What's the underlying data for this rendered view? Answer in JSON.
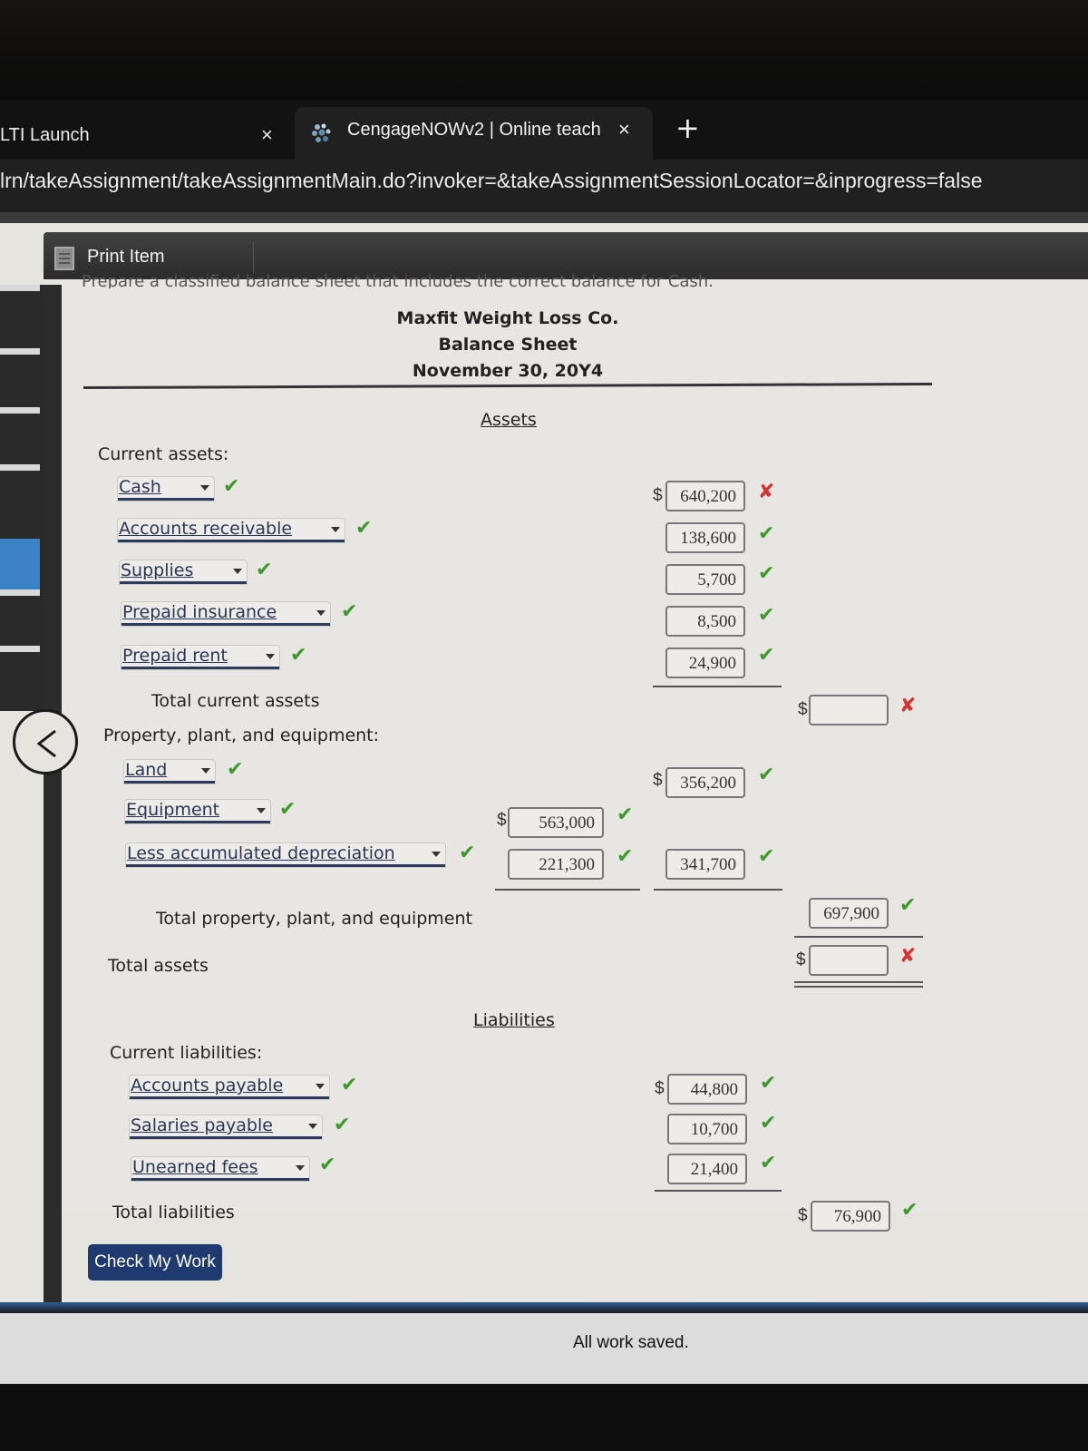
{
  "browser": {
    "tabs": [
      {
        "label": "LTI Launch",
        "active": false
      },
      {
        "label": "CengageNOWv2 | Online teach",
        "active": true
      }
    ],
    "url": "lrn/takeAssignment/takeAssignmentMain.do?invoker=&takeAssignmentSessionLocator=&inprogress=false"
  },
  "toolbar": {
    "print_label": "Print Item"
  },
  "instructions": "Prepare a classified balance sheet that includes the correct balance for Cash.",
  "header": {
    "company": "Maxfit Weight Loss Co.",
    "statement": "Balance Sheet",
    "date": "November 30, 20Y4"
  },
  "assets": {
    "title": "Assets",
    "current_label": "Current assets:",
    "current_items": [
      {
        "account": "Cash",
        "account_status": "correct",
        "amount": "640,200",
        "amount_status": "incorrect",
        "dollar": true
      },
      {
        "account": "Accounts receivable",
        "account_status": "correct",
        "amount": "138,600",
        "amount_status": "correct",
        "dollar": false
      },
      {
        "account": "Supplies",
        "account_status": "correct",
        "amount": "5,700",
        "amount_status": "correct",
        "dollar": false
      },
      {
        "account": "Prepaid insurance",
        "account_status": "correct",
        "amount": "8,500",
        "amount_status": "correct",
        "dollar": false
      },
      {
        "account": "Prepaid rent",
        "account_status": "correct",
        "amount": "24,900",
        "amount_status": "correct",
        "dollar": false
      }
    ],
    "total_current_label": "Total current assets",
    "total_current_value": "",
    "total_current_status": "incorrect",
    "ppe_label": "Property, plant, and equipment:",
    "ppe_items": [
      {
        "account": "Land",
        "account_status": "correct",
        "amount": "356,200",
        "amount_status": "correct"
      },
      {
        "account": "Equipment",
        "account_status": "correct",
        "amount": "563,000",
        "amount_status": "correct"
      },
      {
        "account": "Less accumulated depreciation",
        "account_status": "correct",
        "amount": "221,300",
        "amount_status": "correct",
        "net": "341,700",
        "net_status": "correct"
      }
    ],
    "total_ppe_label": "Total property, plant, and equipment",
    "total_ppe_value": "697,900",
    "total_ppe_status": "correct",
    "total_assets_label": "Total assets",
    "total_assets_value": "",
    "total_assets_status": "incorrect"
  },
  "liabilities": {
    "title": "Liabilities",
    "current_label": "Current liabilities:",
    "items": [
      {
        "account": "Accounts payable",
        "account_status": "correct",
        "amount": "44,800",
        "amount_status": "correct"
      },
      {
        "account": "Salaries payable",
        "account_status": "correct",
        "amount": "10,700",
        "amount_status": "correct"
      },
      {
        "account": "Unearned fees",
        "account_status": "correct",
        "amount": "21,400",
        "amount_status": "correct"
      }
    ],
    "total_label": "Total liabilities",
    "total_value": "76,900",
    "total_status": "correct"
  },
  "symbols": {
    "correct": "✔",
    "incorrect": "✘",
    "dollar": "$"
  },
  "actions": {
    "check_label": "Check My Work"
  },
  "status": {
    "saved": "All work saved."
  }
}
